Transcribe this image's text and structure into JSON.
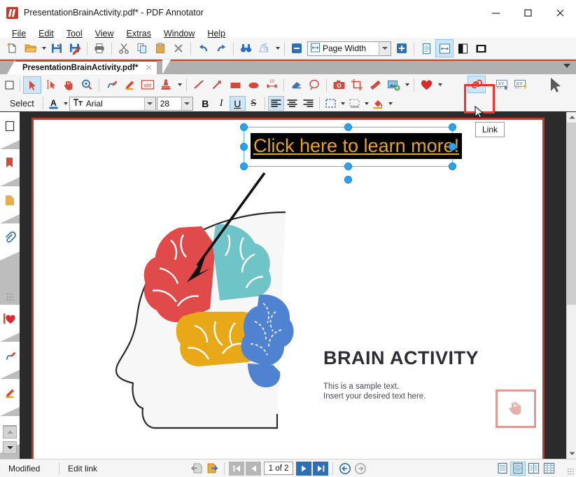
{
  "window": {
    "title": "PresentationBrainActivity.pdf* - PDF Annotator",
    "app_icon": "pdf-annotator-logo-icon",
    "minimize_label": "—",
    "maximize_label": "□",
    "close_label": "✕"
  },
  "menubar": {
    "items": [
      {
        "label": "File"
      },
      {
        "label": "Edit"
      },
      {
        "label": "Tool"
      },
      {
        "label": "View"
      },
      {
        "label": "Extras"
      },
      {
        "label": "Window"
      },
      {
        "label": "Help"
      }
    ]
  },
  "main_toolbar": {
    "buttons": [
      {
        "name": "new-document-button",
        "icon": "new-page-icon"
      },
      {
        "name": "open-document-button",
        "icon": "open-folder-icon"
      },
      {
        "name": "open-dropdown-button",
        "icon": "chevron-down-icon"
      },
      {
        "name": "save-button",
        "icon": "floppy-disk-icon"
      },
      {
        "name": "save-as-button",
        "icon": "floppy-disk-pencil-icon"
      },
      {
        "name": "print-button",
        "icon": "printer-icon"
      },
      {
        "name": "cut-button",
        "icon": "scissors-icon"
      },
      {
        "name": "copy-button",
        "icon": "copy-pages-icon"
      },
      {
        "name": "paste-button",
        "icon": "clipboard-icon"
      },
      {
        "name": "delete-button",
        "icon": "close-x-icon"
      },
      {
        "name": "undo-button",
        "icon": "undo-arrow-icon"
      },
      {
        "name": "redo-button",
        "icon": "redo-arrow-icon"
      },
      {
        "name": "find-button",
        "icon": "binoculars-icon"
      },
      {
        "name": "clear-button",
        "icon": "eraser-sweep-icon"
      },
      {
        "name": "clear-dropdown-button",
        "icon": "chevron-down-icon"
      }
    ],
    "zoom_out_label": "−",
    "zoom_in_label": "+",
    "zoom_value": "Page Width",
    "zoom_icon": "page-width-icon",
    "view_single_page": "single-page-icon",
    "view_page_width": "page-width-view-icon",
    "view_full_page": "full-page-icon",
    "view_window": "window-view-icon"
  },
  "tabstrip": {
    "tab_label": "PresentationBrainActivity.pdf*",
    "close_label": "✕",
    "overflow_icon": "chevron-down-icon"
  },
  "tools_row": {
    "tools": [
      {
        "name": "tool-select",
        "icon": "arrow-cursor-icon",
        "active": true
      },
      {
        "name": "tool-select-text",
        "icon": "text-select-icon",
        "active": false
      },
      {
        "name": "tool-hand",
        "icon": "hand-icon",
        "active": false
      },
      {
        "name": "tool-zoom",
        "icon": "magnifier-plus-icon",
        "active": false
      },
      {
        "name": "tool-pen",
        "icon": "pen-icon",
        "active": false
      },
      {
        "name": "tool-highlighter",
        "icon": "highlighter-icon",
        "active": false
      },
      {
        "name": "tool-textbox",
        "icon": "abl-textbox-icon",
        "active": false
      },
      {
        "name": "tool-stamp",
        "icon": "stamp-icon",
        "active": false
      },
      {
        "name": "tool-stamp-dropdown",
        "icon": "chevron-down-icon",
        "active": false
      },
      {
        "name": "tool-line",
        "icon": "line-icon",
        "active": false
      },
      {
        "name": "tool-arrow",
        "icon": "arrow-icon",
        "active": false
      },
      {
        "name": "tool-rectangle",
        "icon": "filled-rectangle-icon",
        "active": false
      },
      {
        "name": "tool-ellipse",
        "icon": "filled-ellipse-icon",
        "active": false
      },
      {
        "name": "tool-measure",
        "icon": "measure-ruler-icon",
        "active": false
      },
      {
        "name": "tool-eraser",
        "icon": "eraser-icon",
        "active": false
      },
      {
        "name": "tool-lasso",
        "icon": "lasso-icon",
        "active": false
      },
      {
        "name": "tool-snapshot",
        "icon": "camera-icon",
        "active": false
      },
      {
        "name": "tool-crop",
        "icon": "crop-icon",
        "active": false
      },
      {
        "name": "tool-ruler",
        "icon": "ruler-icon",
        "active": false
      },
      {
        "name": "tool-insert-image",
        "icon": "insert-image-icon",
        "active": false
      },
      {
        "name": "tool-insert-image-dropdown",
        "icon": "chevron-down-icon",
        "active": false
      },
      {
        "name": "tool-favorites",
        "icon": "heart-icon",
        "active": false
      },
      {
        "name": "tool-favorites-dropdown",
        "icon": "chevron-down-icon",
        "active": false
      }
    ],
    "link_button": {
      "name": "link-button",
      "icon": "chain-link-icon",
      "active": true
    },
    "xy_button_1": {
      "name": "xy-cursor-button",
      "icon": "xy-cursor-icon"
    },
    "xy_button_2": {
      "name": "xy-flash-button",
      "icon": "xy-flash-icon"
    },
    "pointer_preview": {
      "name": "pointer-preview-icon"
    }
  },
  "tooltip": {
    "text": "Link"
  },
  "format_row": {
    "select_label": "Select",
    "font_color_icon": "font-color-A-icon",
    "font_name": "Arial",
    "font_icon": "font-Tt-icon",
    "font_size": "28",
    "bold_label": "B",
    "italic_label": "I",
    "underline_label": "U",
    "strikethrough_label": "S",
    "align_left_icon": "align-left-icon",
    "align_center_icon": "align-center-icon",
    "align_right_icon": "align-right-icon",
    "border_style_icon": "dashed-border-icon",
    "shadow_style_icon": "shadow-box-icon",
    "fill_color_icon": "fill-bucket-icon",
    "states": {
      "bold": false,
      "italic": false,
      "underline": true,
      "strikethrough": false,
      "align_left": true
    }
  },
  "left_sidebar": {
    "items": [
      {
        "name": "sidebar-thumbnails",
        "icon": "page-outline-icon",
        "active": true
      },
      {
        "name": "sidebar-bookmarks",
        "icon": "red-bookmark-icon",
        "active": false
      },
      {
        "name": "sidebar-pages",
        "icon": "orange-page-icon",
        "active": false
      },
      {
        "name": "sidebar-attachments",
        "icon": "paperclip-icon",
        "active": false
      },
      {
        "name": "sidebar-favorites",
        "icon": "heart-icon",
        "active": false
      },
      {
        "name": "sidebar-pen-tools",
        "icon": "blue-red-pen-icon",
        "active": false
      },
      {
        "name": "sidebar-highlighter",
        "icon": "highlighter-pencil-icon",
        "active": false
      },
      {
        "name": "sidebar-textbox",
        "icon": "abl-textbox-icon",
        "active": false
      }
    ],
    "scroll_up_icon": "chevron-up-icon",
    "scroll_down_icon": "chevron-down-icon"
  },
  "document": {
    "page_title": "BRAIN ACTIVITY",
    "body_line_1": "This is a sample text.",
    "body_line_2": "Insert your desired text here.",
    "hand_icon": "hand-pointer-icon",
    "brain_illustration": "brain-head-silhouette-icon",
    "colors": {
      "brain_red": "#e04a4a",
      "brain_teal": "#6fc4c8",
      "brain_yellow": "#e8a817",
      "brain_blue": "#4f82d0",
      "page_border": "#c0392b",
      "hand_box_border": "#e09a95"
    }
  },
  "annotation": {
    "text": "Click here to learn more!",
    "text_color": "#e8a317",
    "background_color": "#000000",
    "underline": true,
    "selection_color": "#2aa3f0",
    "arrow_icon": "pointer-arrow-annotation-icon"
  },
  "statusbar": {
    "modified_label": "Modified",
    "tool_status_label": "Edit link",
    "prev_view_icon": "previous-view-icon",
    "next_view_icon": "next-view-icon",
    "first_page_icon": "first-page-icon",
    "prev_page_icon": "previous-page-icon",
    "page_indicator": "1 of 2",
    "next_page_icon": "next-page-icon",
    "last_page_icon": "last-page-icon",
    "back_icon": "back-circle-icon",
    "forward_icon": "forward-circle-icon",
    "view_modes": [
      {
        "name": "view-mode-single",
        "icon": "single-column-icon",
        "active": false
      },
      {
        "name": "view-mode-continuous",
        "icon": "continuous-icon",
        "active": true
      },
      {
        "name": "view-mode-facing",
        "icon": "facing-pages-icon",
        "active": false
      },
      {
        "name": "view-mode-grid",
        "icon": "grid-pages-icon",
        "active": false
      }
    ],
    "resize_grip": "resize-grip-icon"
  }
}
